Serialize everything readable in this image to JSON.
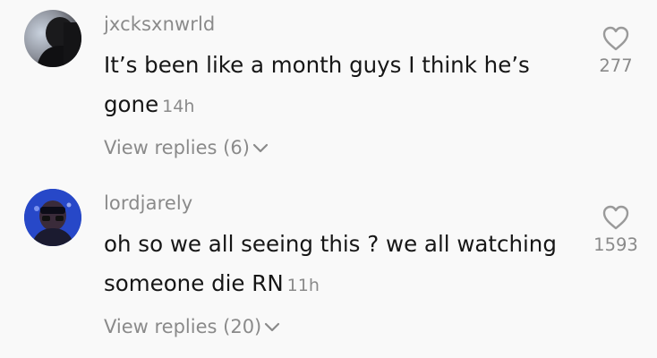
{
  "comments": [
    {
      "username": "jxcksxnwrld",
      "text": "It’s been like a month guys I think he’s gone",
      "time": "14h",
      "replies_label": "View replies (6)",
      "likes": "277",
      "avatar_icon": "person-silhouette-avatar",
      "like_icon": "heart-outline-icon"
    },
    {
      "username": "lordjarely",
      "text": "oh so we all seeing this ? we all watching someone die RN",
      "time": "11h",
      "replies_label": "View replies (20)",
      "likes": "1593",
      "avatar_icon": "person-blue-avatar",
      "like_icon": "heart-outline-icon"
    }
  ],
  "colors": {
    "background": "#f9f9f9",
    "text_primary": "#161616",
    "text_secondary": "#8a8a8a"
  }
}
